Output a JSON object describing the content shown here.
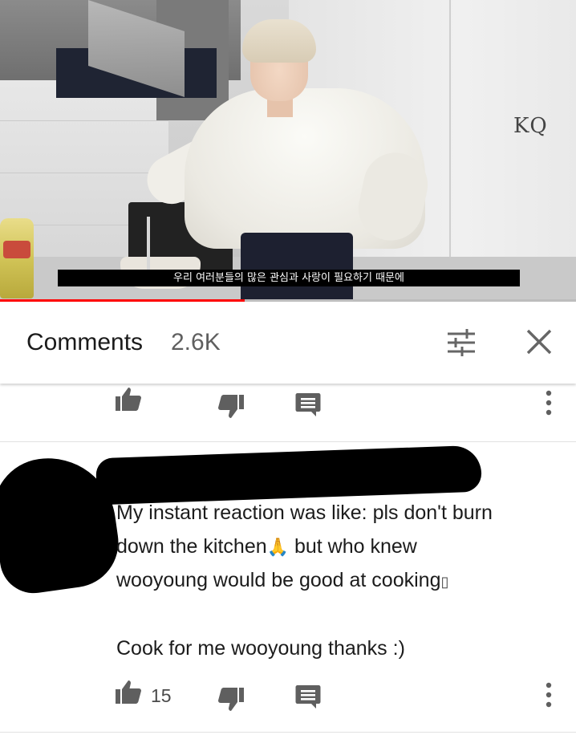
{
  "video": {
    "subtitle": "우리 여러분들의 많은 관심과 사랑이 필요하기 때문에",
    "watermark": "KQ",
    "progress_percent": 42.5,
    "accent_color": "#ff0000"
  },
  "comments_panel": {
    "title": "Comments",
    "count": "2.6K",
    "filter_icon": "tune-icon",
    "close_icon": "close-icon"
  },
  "previous_comment_actions": {
    "like_icon": "thumb-up-icon",
    "dislike_icon": "thumb-down-icon",
    "reply_icon": "reply-icon",
    "menu_icon": "more-vert-icon"
  },
  "comment": {
    "lines": [
      "My instant reaction was like: pls don't burn",
      "down the kitchen",
      " but who knew",
      "wooyoung would be good at cooking",
      "Cook for me wooyoung thanks :)"
    ],
    "emoji_pray": "🙏",
    "emoji_missing": "▯",
    "like_count": "15"
  }
}
